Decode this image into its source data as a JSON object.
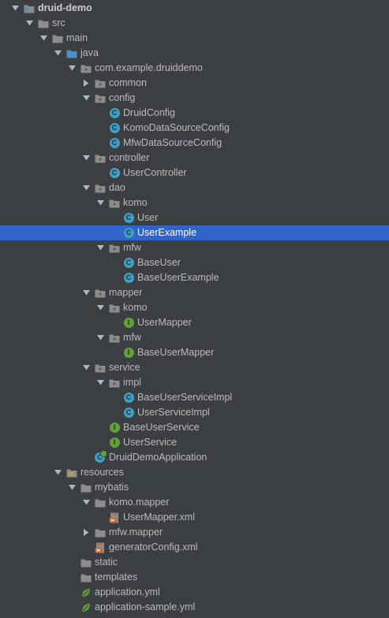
{
  "tree": [
    {
      "depth": 0,
      "type": "module",
      "label": "druid-demo",
      "expanded": true,
      "bold": true
    },
    {
      "depth": 1,
      "type": "folder",
      "label": "src",
      "expanded": true
    },
    {
      "depth": 2,
      "type": "folder",
      "label": "main",
      "expanded": true
    },
    {
      "depth": 3,
      "type": "source-folder",
      "label": "java",
      "expanded": true
    },
    {
      "depth": 4,
      "type": "package",
      "label": "com.example.druiddemo",
      "expanded": true
    },
    {
      "depth": 5,
      "type": "package",
      "label": "common",
      "expanded": false
    },
    {
      "depth": 5,
      "type": "package",
      "label": "config",
      "expanded": true
    },
    {
      "depth": 6,
      "type": "class",
      "label": "DruidConfig"
    },
    {
      "depth": 6,
      "type": "class",
      "label": "KomoDataSourceConfig"
    },
    {
      "depth": 6,
      "type": "class",
      "label": "MfwDataSourceConfig"
    },
    {
      "depth": 5,
      "type": "package",
      "label": "controller",
      "expanded": true
    },
    {
      "depth": 6,
      "type": "class",
      "label": "UserController"
    },
    {
      "depth": 5,
      "type": "package",
      "label": "dao",
      "expanded": true
    },
    {
      "depth": 6,
      "type": "package",
      "label": "komo",
      "expanded": true
    },
    {
      "depth": 7,
      "type": "class",
      "label": "User"
    },
    {
      "depth": 7,
      "type": "class",
      "label": "UserExample",
      "selected": true
    },
    {
      "depth": 6,
      "type": "package",
      "label": "mfw",
      "expanded": true
    },
    {
      "depth": 7,
      "type": "class",
      "label": "BaseUser"
    },
    {
      "depth": 7,
      "type": "class",
      "label": "BaseUserExample"
    },
    {
      "depth": 5,
      "type": "package",
      "label": "mapper",
      "expanded": true
    },
    {
      "depth": 6,
      "type": "package",
      "label": "komo",
      "expanded": true
    },
    {
      "depth": 7,
      "type": "interface",
      "label": "UserMapper"
    },
    {
      "depth": 6,
      "type": "package",
      "label": "mfw",
      "expanded": true
    },
    {
      "depth": 7,
      "type": "interface",
      "label": "BaseUserMapper"
    },
    {
      "depth": 5,
      "type": "package",
      "label": "service",
      "expanded": true
    },
    {
      "depth": 6,
      "type": "package",
      "label": "impl",
      "expanded": true
    },
    {
      "depth": 7,
      "type": "class",
      "label": "BaseUserServiceImpl"
    },
    {
      "depth": 7,
      "type": "class",
      "label": "UserServiceImpl"
    },
    {
      "depth": 6,
      "type": "interface",
      "label": "BaseUserService"
    },
    {
      "depth": 6,
      "type": "interface",
      "label": "UserService"
    },
    {
      "depth": 5,
      "type": "spring-app",
      "label": "DruidDemoApplication"
    },
    {
      "depth": 3,
      "type": "resources-folder",
      "label": "resources",
      "expanded": true
    },
    {
      "depth": 4,
      "type": "folder",
      "label": "mybatis",
      "expanded": true
    },
    {
      "depth": 5,
      "type": "folder",
      "label": "komo.mapper",
      "expanded": true
    },
    {
      "depth": 6,
      "type": "xml",
      "label": "UserMapper.xml"
    },
    {
      "depth": 5,
      "type": "folder",
      "label": "mfw.mapper",
      "expanded": false
    },
    {
      "depth": 5,
      "type": "xml",
      "label": "generatorConfig.xml"
    },
    {
      "depth": 4,
      "type": "folder",
      "label": "static"
    },
    {
      "depth": 4,
      "type": "folder",
      "label": "templates"
    },
    {
      "depth": 4,
      "type": "yml",
      "label": "application.yml"
    },
    {
      "depth": 4,
      "type": "yml",
      "label": "application-sample.yml"
    }
  ],
  "badges": {
    "class": "C",
    "interface": "I"
  },
  "colors": {
    "background": "#3c3f41",
    "selection": "#2f65ca",
    "text": "#bbbbbb",
    "class_badge": "#3fa0c4",
    "interface_badge": "#62a03c",
    "folder": "#8c8c8c",
    "source_folder": "#4b8fc4"
  }
}
